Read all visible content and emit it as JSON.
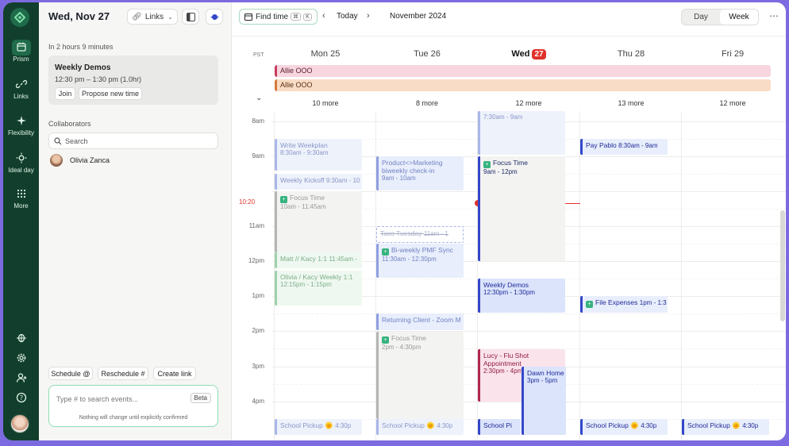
{
  "rail": {
    "items": [
      {
        "label": "Prism",
        "icon": "calendar-icon"
      },
      {
        "label": "Links",
        "icon": "link-icon"
      },
      {
        "label": "Flexibility",
        "icon": "sparkle-icon"
      },
      {
        "label": "Ideal day",
        "icon": "sun-icon"
      },
      {
        "label": "More",
        "icon": "grid-dots-icon"
      }
    ]
  },
  "side": {
    "date": "Wed, Nov 27",
    "links_label": "Links",
    "countdown": "In 2 hours 9 minutes",
    "next_event": {
      "title": "Weekly Demos",
      "time": "12:30 pm – 1:30 pm (1.0hr)",
      "join": "Join",
      "propose": "Propose new time"
    },
    "collaborators_title": "Collaborators",
    "search_placeholder": "Search",
    "collaborator": "Olivia Zanca",
    "schedule_buttons": [
      "Schedule @",
      "Reschedule #",
      "Create link"
    ],
    "ai_placeholder": "Type # to search events...",
    "beta": "Beta",
    "ai_note": "Nothing will change until explicitly confirmed"
  },
  "toolbar": {
    "find_time": "Find time",
    "kbd1": "⌘",
    "kbd2": "K",
    "today": "Today",
    "month": "November 2024",
    "view_day": "Day",
    "view_week": "Week"
  },
  "calendar": {
    "timezone": "PST",
    "days": [
      {
        "label": "Mon 25",
        "more": "10 more"
      },
      {
        "label": "Tue 26",
        "more": "8 more"
      },
      {
        "label": "Wed",
        "num": "27",
        "more": "12 more"
      },
      {
        "label": "Thu 28",
        "more": "13 more"
      },
      {
        "label": "Fri 29",
        "more": "12 more"
      }
    ],
    "allday": [
      {
        "title": "Allie OOO",
        "color": "#f7d6df"
      },
      {
        "title": "Allie OOO",
        "color": "#f9dcc6"
      }
    ],
    "hours": [
      "8am",
      "9am",
      "11am",
      "12pm",
      "1pm",
      "2pm",
      "3pm",
      "4pm"
    ],
    "now_label": "10:20",
    "events": {
      "e1": {
        "title": "Write Weekplan",
        "time": "8:30am - 9:30am"
      },
      "e2": {
        "title": "Weekly Kickoff",
        "time": "9:30am - 10"
      },
      "e3": {
        "title": "Focus Time",
        "time": "10am - 11:45am"
      },
      "e4": {
        "title": "Matt // Kacy 1:1",
        "time": "11:45am -"
      },
      "e5": {
        "title": "Olivia / Kacy Weekly 1:1",
        "time": "12:15pm - 1:15pm"
      },
      "e6": {
        "title": "School Pickup 🌞",
        "time": "4:30p"
      },
      "e7": {
        "title": "Product<>Marketing biweekly check-in",
        "time": "9am - 10am"
      },
      "e8": {
        "title": "Taco Tuesday",
        "time": "11am - 1"
      },
      "e9": {
        "title": "Bi-weekly PMF Sync",
        "time": "11:30am - 12:30pm"
      },
      "e10": {
        "title": "Returning Client - Zoom M",
        "time": ""
      },
      "e11": {
        "title": "Focus Time",
        "time": "2pm - 4:30pm"
      },
      "e12": {
        "title": "School Pickup 🌞",
        "time": "4:30p"
      },
      "e13": {
        "title": "",
        "time": "7:30am - 9am"
      },
      "e14": {
        "title": "Focus Time",
        "time": "9am - 12pm"
      },
      "e15": {
        "title": "Weekly Demos",
        "time": "12:30pm - 1:30pm"
      },
      "e16": {
        "title": "Lucy - Flu Shot Appointment",
        "time": "2:30pm - 4pm"
      },
      "e17": {
        "title": "Dawn Home",
        "time": "3pm - 5pm"
      },
      "e18": {
        "title": "School Pi",
        "time": ""
      },
      "e19": {
        "title": "Pay Pablo",
        "time": "8:30am - 9am"
      },
      "e20": {
        "title": "File Expenses",
        "time": "1pm - 1:3"
      },
      "e21": {
        "title": "School Pickup 🌞",
        "time": "4:30p"
      },
      "e22": {
        "title": "School Pickup 🌞",
        "time": "4:30p"
      }
    }
  },
  "colors": {
    "accent": "#36b37e",
    "rail": "#123f2d",
    "now": "#e0322c",
    "event_blue": "#3447c9"
  }
}
